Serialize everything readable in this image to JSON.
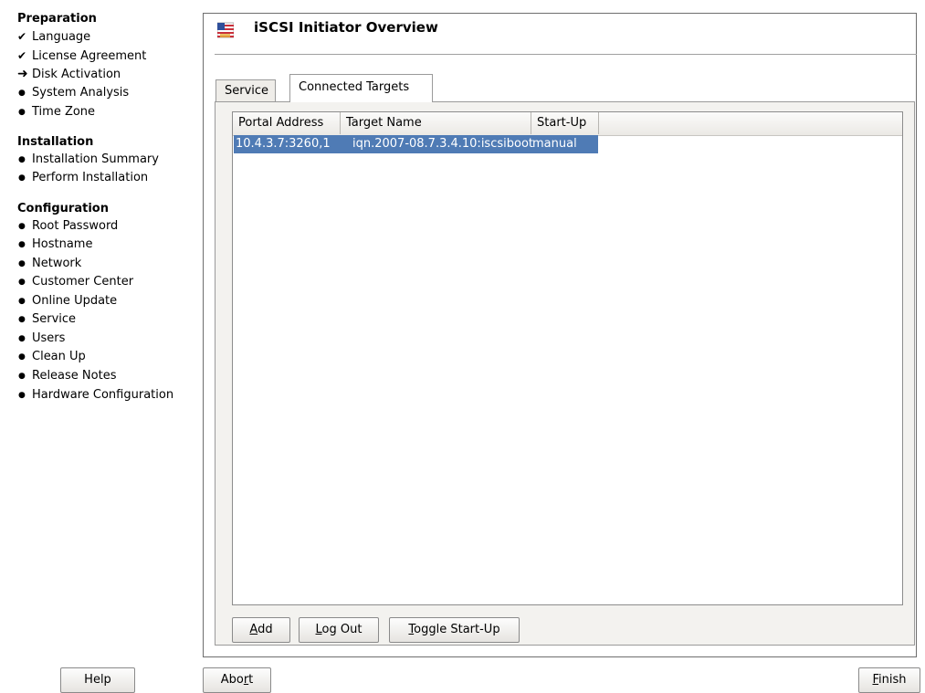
{
  "sidebar": {
    "sections": [
      {
        "title": "Preparation",
        "steps": [
          {
            "label": "Language",
            "mark": "✔"
          },
          {
            "label": "License Agreement",
            "mark": "✔"
          },
          {
            "label": "Disk Activation",
            "mark": "➜"
          },
          {
            "label": "System Analysis",
            "mark": "●"
          },
          {
            "label": "Time Zone",
            "mark": "●"
          }
        ]
      },
      {
        "title": "Installation",
        "steps": [
          {
            "label": "Installation Summary",
            "mark": "●"
          },
          {
            "label": "Perform Installation",
            "mark": "●"
          }
        ]
      },
      {
        "title": "Configuration",
        "steps": [
          {
            "label": "Root Password",
            "mark": "●"
          },
          {
            "label": "Hostname",
            "mark": "●"
          },
          {
            "label": "Network",
            "mark": "●"
          },
          {
            "label": "Customer Center",
            "mark": "●"
          },
          {
            "label": "Online Update",
            "mark": "●"
          },
          {
            "label": "Service",
            "mark": "●"
          },
          {
            "label": "Users",
            "mark": "●"
          },
          {
            "label": "Clean Up",
            "mark": "●"
          },
          {
            "label": "Release Notes",
            "mark": "●"
          },
          {
            "label": "Hardware Configuration",
            "mark": "●"
          }
        ]
      }
    ]
  },
  "main": {
    "title": "iSCSI Initiator Overview",
    "tabs": [
      {
        "label": "Service",
        "active": false
      },
      {
        "label": "Connected Targets",
        "active": true
      }
    ],
    "table": {
      "columns": [
        "Portal Address",
        "Target Name",
        "Start-Up"
      ],
      "rows": [
        [
          "10.4.3.7:3260,1",
          "iqn.2007-08.7.3.4.10:iscsiboot",
          "manual"
        ]
      ],
      "selected_color": "#4f7bb5"
    },
    "buttons": {
      "add": {
        "pre": "",
        "u": "A",
        "post": "dd"
      },
      "logout": {
        "pre": "",
        "u": "L",
        "post": "og Out"
      },
      "toggle": {
        "pre": "",
        "u": "T",
        "post": "oggle Start-Up"
      }
    }
  },
  "footer": {
    "help": "Help",
    "abort": {
      "pre": "Abo",
      "u": "r",
      "post": "t"
    },
    "finish": {
      "pre": "",
      "u": "F",
      "post": "inish"
    }
  }
}
